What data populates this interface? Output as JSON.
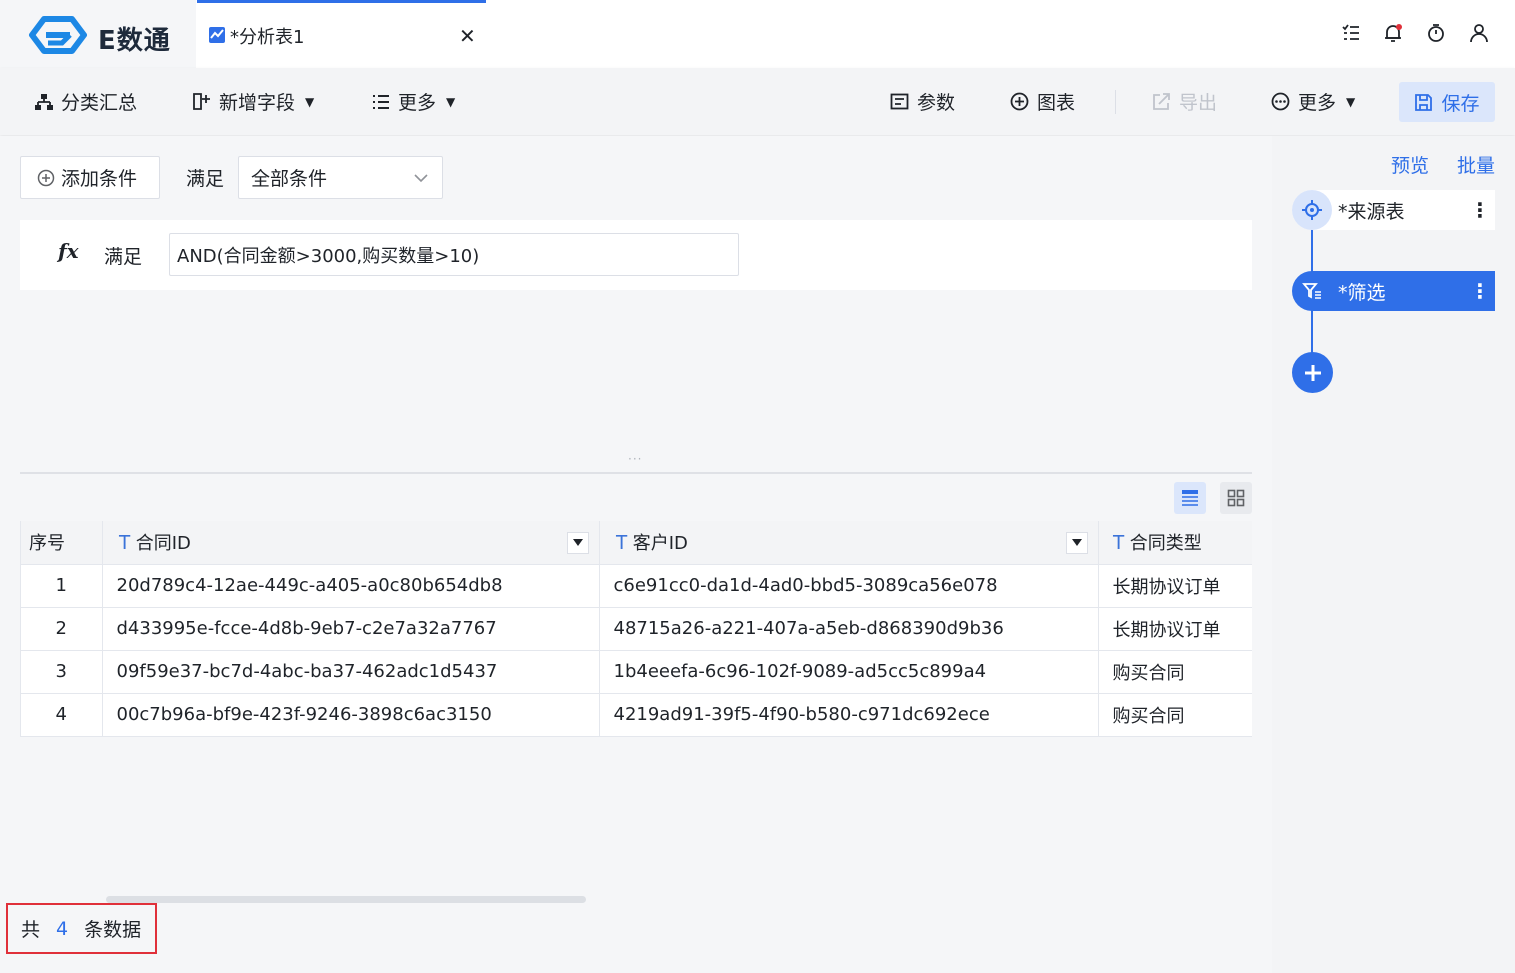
{
  "app": {
    "logo_text": "E数通"
  },
  "tab": {
    "title": "*分析表1",
    "close": "✕"
  },
  "toolbar": {
    "group_summary": "分类汇总",
    "add_field": "新增字段",
    "more_left": "更多",
    "params": "参数",
    "chart": "图表",
    "export": "导出",
    "more_right": "更多",
    "save": "保存"
  },
  "filter": {
    "add_condition": "添加条件",
    "satisfy_label": "满足",
    "condition_mode": "全部条件",
    "formula_satisfy": "满足",
    "formula": "AND(合同金额>3000,购买数量>10)",
    "fx": "fx"
  },
  "table": {
    "columns": [
      "序号",
      "合同ID",
      "客户ID",
      "合同类型"
    ],
    "rows": [
      [
        "1",
        "20d789c4-12ae-449c-a405-a0c80b654db8",
        "c6e91cc0-da1d-4ad0-bbd5-3089ca56e078",
        "长期协议订单"
      ],
      [
        "2",
        "d433995e-fcce-4d8b-9eb7-c2e7a32a7767",
        "48715a26-a221-407a-a5eb-d868390d9b36",
        "长期协议订单"
      ],
      [
        "3",
        "09f59e37-bc7d-4abc-ba37-462adc1d5437",
        "1b4eeefa-6c96-102f-9089-ad5cc5c899a4",
        "购买合同"
      ],
      [
        "4",
        "00c7b96a-bf9e-423f-9246-3898c6ac3150",
        "4219ad91-39f5-4f90-b580-c971dc692ece",
        "购买合同"
      ]
    ]
  },
  "footer": {
    "prefix": "共",
    "count": "4",
    "suffix": "条数据"
  },
  "right_panel": {
    "preview": "预览",
    "batch": "批量",
    "nodes": [
      {
        "label": "*来源表"
      },
      {
        "label": "*筛选"
      }
    ],
    "kebab": "⋮"
  },
  "colors": {
    "accent": "#2f6fe8",
    "highlight_border": "#e0303a"
  }
}
